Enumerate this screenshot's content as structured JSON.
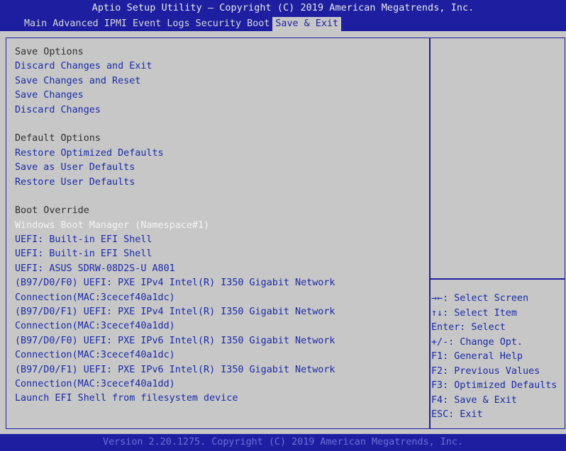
{
  "header": {
    "title": "Aptio Setup Utility – Copyright (C) 2019 American Megatrends, Inc.",
    "tabs": [
      {
        "label": "Main"
      },
      {
        "label": "Advanced"
      },
      {
        "label": "IPMI"
      },
      {
        "label": "Event Logs"
      },
      {
        "label": "Security"
      },
      {
        "label": "Boot"
      },
      {
        "label": "Save & Exit"
      }
    ],
    "active_tab": "Save & Exit"
  },
  "menu": {
    "save_options": {
      "heading": "Save Options",
      "items": [
        {
          "label": "Discard Changes and Exit"
        },
        {
          "label": "Save Changes and Reset"
        },
        {
          "label": "Save Changes"
        },
        {
          "label": "Discard Changes"
        }
      ]
    },
    "default_options": {
      "heading": "Default Options",
      "items": [
        {
          "label": "Restore Optimized Defaults"
        },
        {
          "label": "Save as User Defaults"
        },
        {
          "label": "Restore User Defaults"
        }
      ]
    },
    "boot_override": {
      "heading": "Boot Override",
      "selected_item": "Windows Boot Manager (Namespace#1)",
      "items": [
        {
          "label": "Windows Boot Manager (Namespace#1)"
        },
        {
          "label": "UEFI: Built-in EFI Shell"
        },
        {
          "label": "UEFI: Built-in EFI Shell"
        },
        {
          "label": "UEFI: ASUS SDRW-08D2S-U A801"
        },
        {
          "line1": "(B97/D0/F0) UEFI: PXE IPv4 Intel(R) I350 Gigabit Network",
          "line2": "Connection(MAC:3cecef40a1dc)"
        },
        {
          "line1": "(B97/D0/F1) UEFI: PXE IPv4 Intel(R) I350 Gigabit Network",
          "line2": "Connection(MAC:3cecef40a1dd)"
        },
        {
          "line1": "(B97/D0/F0) UEFI: PXE IPv6 Intel(R) I350 Gigabit Network",
          "line2": "Connection(MAC:3cecef40a1dc)"
        },
        {
          "line1": "(B97/D0/F1) UEFI: PXE IPv6 Intel(R) I350 Gigabit Network",
          "line2": "Connection(MAC:3cecef40a1dd)"
        },
        {
          "label": "Launch EFI Shell from filesystem device"
        }
      ]
    }
  },
  "help": {
    "lines": [
      "→←: Select Screen",
      "↑↓: Select Item",
      "Enter: Select",
      "+/-: Change Opt.",
      "F1: General Help",
      "F2: Previous Values",
      "F3: Optimized Defaults",
      "F4: Save & Exit",
      "ESC: Exit"
    ]
  },
  "footer": {
    "text": "Version 2.20.1275. Copyright (C) 2019 American Megatrends, Inc."
  },
  "colors": {
    "bar_blue": "#1d1fa0",
    "background_gray": "#c7c7c7",
    "item_blue": "#1b2aa8",
    "selected_white": "#f4f4f4"
  }
}
